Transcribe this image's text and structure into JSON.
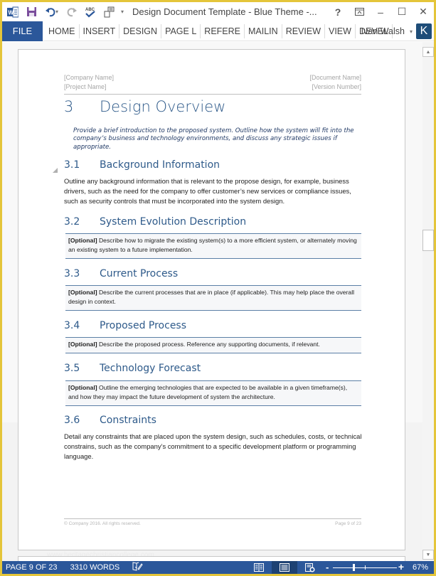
{
  "window": {
    "title": "Design Document Template - Blue Theme -...",
    "controls": {
      "help": "?",
      "ribbon_display": "ribbon-display-options",
      "minimize": "–",
      "maximize": "☐",
      "close": "✕"
    }
  },
  "quick_access": {
    "app_icon": "word-icon",
    "items": [
      "save-icon",
      "undo-icon",
      "redo-icon",
      "spelling-icon",
      "new-comment-icon",
      "customize-icon"
    ]
  },
  "ribbon": {
    "file_label": "FILE",
    "tabs": [
      "HOME",
      "INSERT",
      "DESIGN",
      "PAGE L",
      "REFERE",
      "MAILIN",
      "REVIEW",
      "VIEW",
      "DEVEL"
    ],
    "user_name": "Ivan Walsh",
    "avatar_letter": "K"
  },
  "document": {
    "header": {
      "company": "[Company Name]",
      "project": "[Project Name]",
      "document_name": "[Document Name]",
      "version": "[Version Number]"
    },
    "heading1": {
      "number": "3",
      "title": "Design Overview"
    },
    "intro": "Provide a brief introduction to the proposed system. Outline how the system will fit into the company’s business and technology environments, and discuss any strategic issues if appropriate.",
    "sections": [
      {
        "number": "3.1",
        "title": "Background Information",
        "body": "Outline any background information that is relevant to the propose design, for example, business drivers, such as the need for the company to offer customer’s new services or compliance issues, such as security controls that must be incorporated into the system design."
      },
      {
        "number": "3.2",
        "title": "System Evolution Description",
        "optional_tag": "[Optional]",
        "body": " Describe how to migrate the existing system(s) to a more efficient system, or alternately moving an existing system to a future implementation."
      },
      {
        "number": "3.3",
        "title": "Current Process",
        "optional_tag": "[Optional]",
        "body": " Describe the current processes that are in place (if applicable). This may help place the overall design in context."
      },
      {
        "number": "3.4",
        "title": "Proposed Process",
        "optional_tag": "[Optional]",
        "body": " Describe the proposed process. Reference any supporting documents, if relevant."
      },
      {
        "number": "3.5",
        "title": "Technology Forecast",
        "optional_tag": "[Optional]",
        "body": " Outline the emerging technologies that are expected to be available in a given timeframe(s), and how they may impact the future development of system the architecture."
      },
      {
        "number": "3.6",
        "title": "Constraints",
        "body": "Detail any constraints that are placed upon the system design, such as schedules, costs, or technical constrains, such as the company’s commitment to a specific development platform or programming language."
      }
    ],
    "footer": {
      "copyright": "© Company 2016. All rights reserved.",
      "page": "Page 9 of 23"
    },
    "watermark": "www.heritagechristiancollege.com"
  },
  "status_bar": {
    "page": "PAGE 9 OF 23",
    "words": "3310 WORDS",
    "proofing_icon": "proofing-icon",
    "views": [
      "read-mode-icon",
      "print-layout-icon",
      "web-layout-icon"
    ],
    "active_view": "print-layout",
    "zoom_percent": "67%",
    "zoom_value": 67
  },
  "colors": {
    "accent": "#2b579a",
    "heading": "#2e5a8a",
    "window_border": "#e4c53a"
  }
}
